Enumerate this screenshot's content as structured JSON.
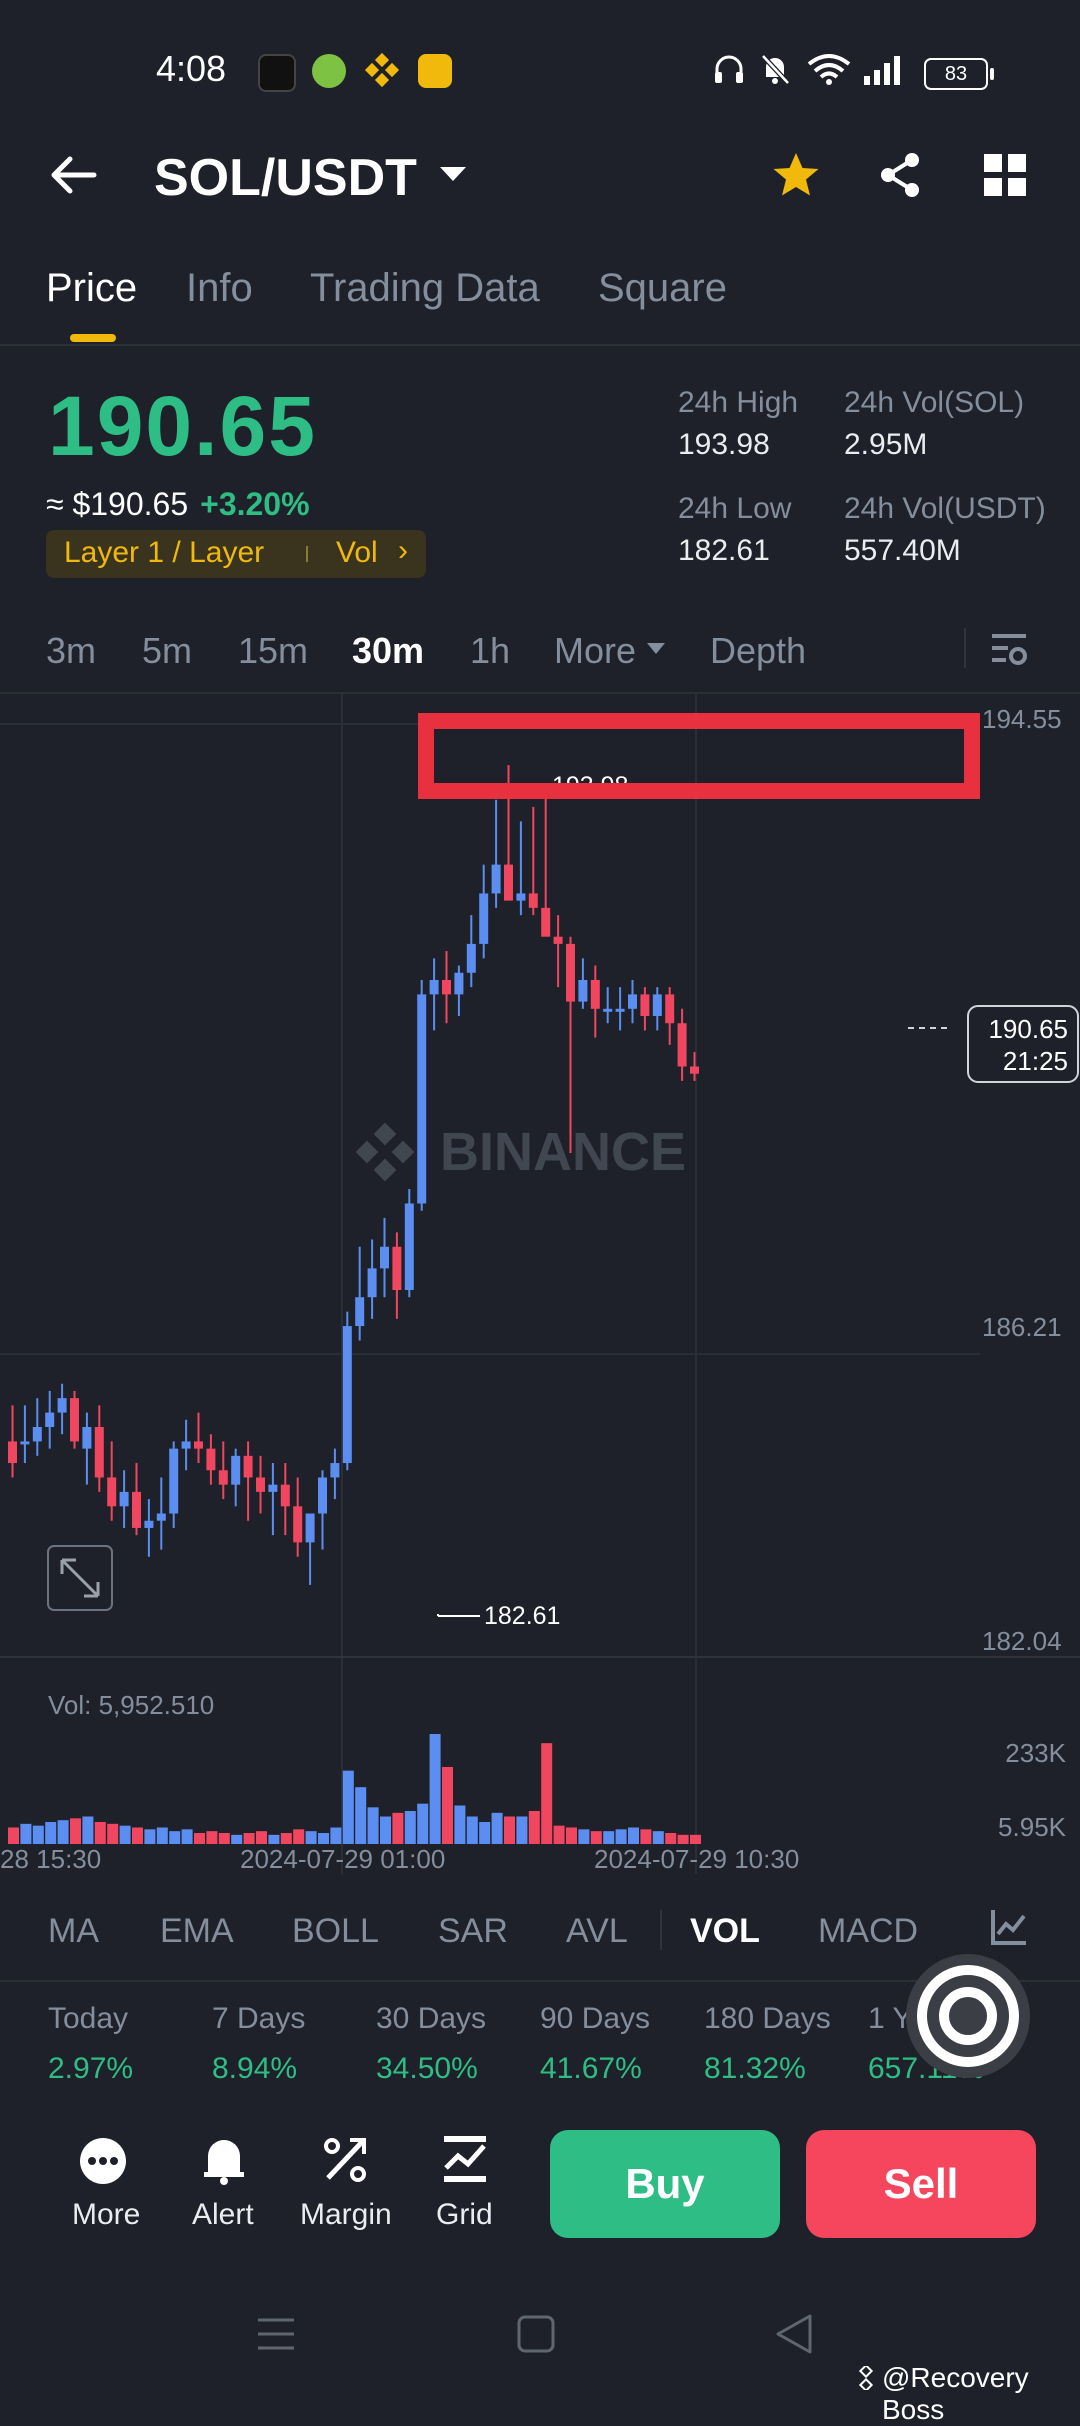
{
  "status_bar": {
    "time": "4:08",
    "battery": "83"
  },
  "header": {
    "pair": "SOL/USDT"
  },
  "tabs": [
    {
      "label": "Price",
      "active": true
    },
    {
      "label": "Info"
    },
    {
      "label": "Trading Data"
    },
    {
      "label": "Square"
    }
  ],
  "ticker": {
    "last_price": "190.65",
    "usd_price": "≈ $190.65",
    "change": "+3.20%",
    "tag": "Layer 1 / Layer",
    "tag_vol": "Vol",
    "high_label": "24h High",
    "high_value": "193.98",
    "low_label": "24h Low",
    "low_value": "182.61",
    "vol_sol_label": "24h Vol(SOL)",
    "vol_sol_value": "2.95M",
    "vol_usdt_label": "24h Vol(USDT)",
    "vol_usdt_value": "557.40M"
  },
  "intervals": [
    "3m",
    "5m",
    "15m",
    "30m",
    "1h",
    "More",
    "Depth"
  ],
  "active_interval": "30m",
  "chart_data": {
    "type": "candlestick",
    "watermark": "BINANCE",
    "y_ticks": [
      "194.55",
      "186.21",
      "182.04"
    ],
    "ylim": [
      182.04,
      194.55
    ],
    "high_marker": "193.98",
    "low_marker": "182.61",
    "last_price_tag": {
      "price": "190.65",
      "countdown": "21:25"
    },
    "x_ticks": [
      "28 15:30",
      "2024-07-29 01:00",
      "2024-07-29 10:30"
    ],
    "volume_label": "Vol: 5,952.510",
    "volume_ticks": [
      "233K",
      "5.95K"
    ],
    "candles": [
      [
        184.6,
        185.1,
        184.1,
        184.3
      ],
      [
        184.6,
        185.1,
        184.3,
        184.6
      ],
      [
        184.6,
        185.2,
        184.4,
        184.8
      ],
      [
        184.8,
        185.3,
        184.5,
        185.0
      ],
      [
        185.0,
        185.4,
        184.7,
        185.2
      ],
      [
        185.2,
        185.3,
        184.5,
        184.6
      ],
      [
        184.5,
        185.0,
        184.0,
        184.8
      ],
      [
        184.8,
        185.1,
        183.9,
        184.1
      ],
      [
        184.1,
        184.6,
        183.5,
        183.7
      ],
      [
        183.7,
        184.2,
        183.4,
        183.9
      ],
      [
        183.9,
        184.3,
        183.3,
        183.4
      ],
      [
        183.4,
        183.8,
        183.0,
        183.5
      ],
      [
        183.5,
        184.1,
        183.1,
        183.6
      ],
      [
        183.6,
        184.6,
        183.4,
        184.5
      ],
      [
        184.5,
        184.9,
        184.2,
        184.6
      ],
      [
        184.6,
        185.0,
        184.3,
        184.5
      ],
      [
        184.5,
        184.7,
        184.0,
        184.2
      ],
      [
        184.2,
        184.6,
        183.8,
        184.0
      ],
      [
        184.0,
        184.5,
        183.7,
        184.4
      ],
      [
        184.4,
        184.6,
        183.5,
        184.1
      ],
      [
        184.1,
        184.4,
        183.6,
        183.9
      ],
      [
        183.9,
        184.3,
        183.3,
        184.0
      ],
      [
        184.0,
        184.3,
        183.3,
        183.7
      ],
      [
        183.7,
        184.1,
        183.0,
        183.2
      ],
      [
        183.2,
        183.5,
        182.61,
        183.6
      ],
      [
        183.6,
        184.2,
        183.1,
        184.1
      ],
      [
        184.1,
        184.5,
        183.8,
        184.3
      ],
      [
        184.3,
        186.4,
        184.2,
        186.2
      ],
      [
        186.2,
        187.3,
        186.0,
        186.6
      ],
      [
        186.6,
        187.4,
        186.3,
        187.0
      ],
      [
        187.0,
        187.7,
        186.6,
        187.3
      ],
      [
        187.3,
        187.5,
        186.3,
        186.7
      ],
      [
        186.7,
        188.1,
        186.6,
        187.9
      ],
      [
        187.9,
        191.0,
        187.8,
        190.8
      ],
      [
        190.8,
        191.3,
        190.3,
        191.0
      ],
      [
        191.0,
        191.4,
        190.4,
        190.8
      ],
      [
        190.8,
        191.2,
        190.5,
        191.1
      ],
      [
        191.1,
        191.9,
        190.9,
        191.5
      ],
      [
        191.5,
        192.6,
        191.3,
        192.2
      ],
      [
        192.2,
        193.5,
        192.0,
        192.6
      ],
      [
        192.6,
        193.98,
        192.4,
        192.1
      ],
      [
        192.1,
        193.2,
        191.9,
        192.2
      ],
      [
        192.2,
        193.4,
        191.9,
        192.0
      ],
      [
        192.0,
        193.7,
        191.8,
        191.6
      ],
      [
        191.6,
        191.9,
        190.9,
        191.5
      ],
      [
        191.5,
        191.6,
        188.6,
        190.7
      ],
      [
        190.7,
        191.3,
        190.6,
        191.0
      ],
      [
        191.0,
        191.2,
        190.2,
        190.6
      ],
      [
        190.6,
        190.9,
        190.4,
        190.6
      ],
      [
        190.6,
        190.9,
        190.3,
        190.6
      ],
      [
        190.6,
        191.0,
        190.4,
        190.8
      ],
      [
        190.8,
        190.9,
        190.3,
        190.5
      ],
      [
        190.5,
        190.9,
        190.3,
        190.8
      ],
      [
        190.8,
        190.9,
        190.1,
        190.4
      ],
      [
        190.4,
        190.6,
        189.6,
        189.8
      ],
      [
        189.8,
        190.0,
        189.6,
        189.7
      ]
    ],
    "volumes": [
      18,
      22,
      20,
      24,
      26,
      28,
      30,
      24,
      22,
      20,
      18,
      16,
      18,
      14,
      16,
      12,
      14,
      12,
      10,
      12,
      14,
      10,
      12,
      16,
      14,
      12,
      18,
      80,
      62,
      40,
      30,
      34,
      36,
      44,
      120,
      84,
      42,
      30,
      24,
      34,
      30,
      30,
      36,
      110,
      20,
      18,
      16,
      14,
      14,
      16,
      18,
      16,
      14,
      12,
      10,
      10
    ]
  },
  "indicators": [
    "MA",
    "EMA",
    "BOLL",
    "SAR",
    "AVL",
    "VOL",
    "MACD"
  ],
  "active_indicator": "VOL",
  "performance": [
    {
      "label": "Today",
      "value": "2.97%"
    },
    {
      "label": "7 Days",
      "value": "8.94%"
    },
    {
      "label": "30 Days",
      "value": "34.50%"
    },
    {
      "label": "90 Days",
      "value": "41.67%"
    },
    {
      "label": "180 Days",
      "value": "81.32%"
    },
    {
      "label": "1 Year",
      "value": "657.11%"
    }
  ],
  "bottom_actions": [
    "More",
    "Alert",
    "Margin",
    "Grid"
  ],
  "buy_label": "Buy",
  "sell_label": "Sell",
  "watermark_credit": "@Recovery Boss",
  "colors": {
    "up": "#2ebd85",
    "down": "#f6465d",
    "candle_up": "#5b8ef0",
    "candle_down": "#f0465f",
    "accent": "#f0b90b"
  }
}
